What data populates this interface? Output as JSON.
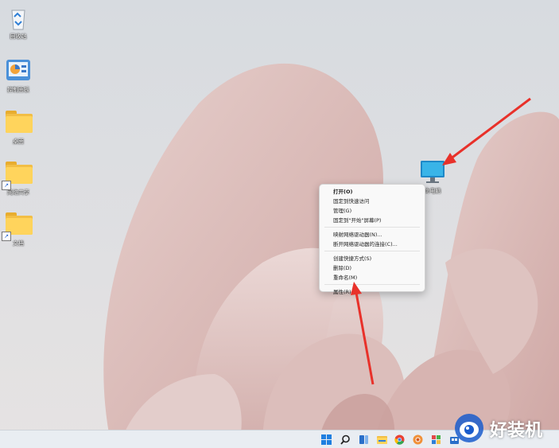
{
  "desktop": {
    "icons": [
      {
        "label": "回收站",
        "icon": "recycle-bin-icon"
      },
      {
        "label": "控制面板",
        "icon": "control-panel-icon"
      },
      {
        "label": "桌面",
        "icon": "folder-icon"
      },
      {
        "label": "网络共享",
        "icon": "folder-shortcut-icon"
      },
      {
        "label": "文档",
        "icon": "folder-shortcut-icon"
      },
      {
        "label": "此电脑",
        "icon": "monitor-icon"
      }
    ]
  },
  "context_menu": {
    "items": [
      {
        "label": "打开(O)"
      },
      {
        "label": "固定到快速访问"
      },
      {
        "label": "管理(G)"
      },
      {
        "label": "固定到\"开始\"屏幕(P)"
      },
      {
        "label": "映射网络驱动器(N)..."
      },
      {
        "label": "断开网络驱动器的连接(C)..."
      },
      {
        "label": "创建快捷方式(S)"
      },
      {
        "label": "删除(D)"
      },
      {
        "label": "重命名(M)"
      },
      {
        "label": "属性(R)"
      }
    ]
  },
  "taskbar": {
    "icons": [
      "start-icon",
      "search-icon",
      "task-view-icon",
      "file-explorer-icon",
      "chrome-icon",
      "browser-icon",
      "settings-icon",
      "store-icon"
    ]
  },
  "watermark": {
    "text": "好装机"
  },
  "colors": {
    "annotation_arrow": "#e8312a",
    "taskbar": "#e9edf2",
    "menu_bg": "#f9f9f9"
  }
}
